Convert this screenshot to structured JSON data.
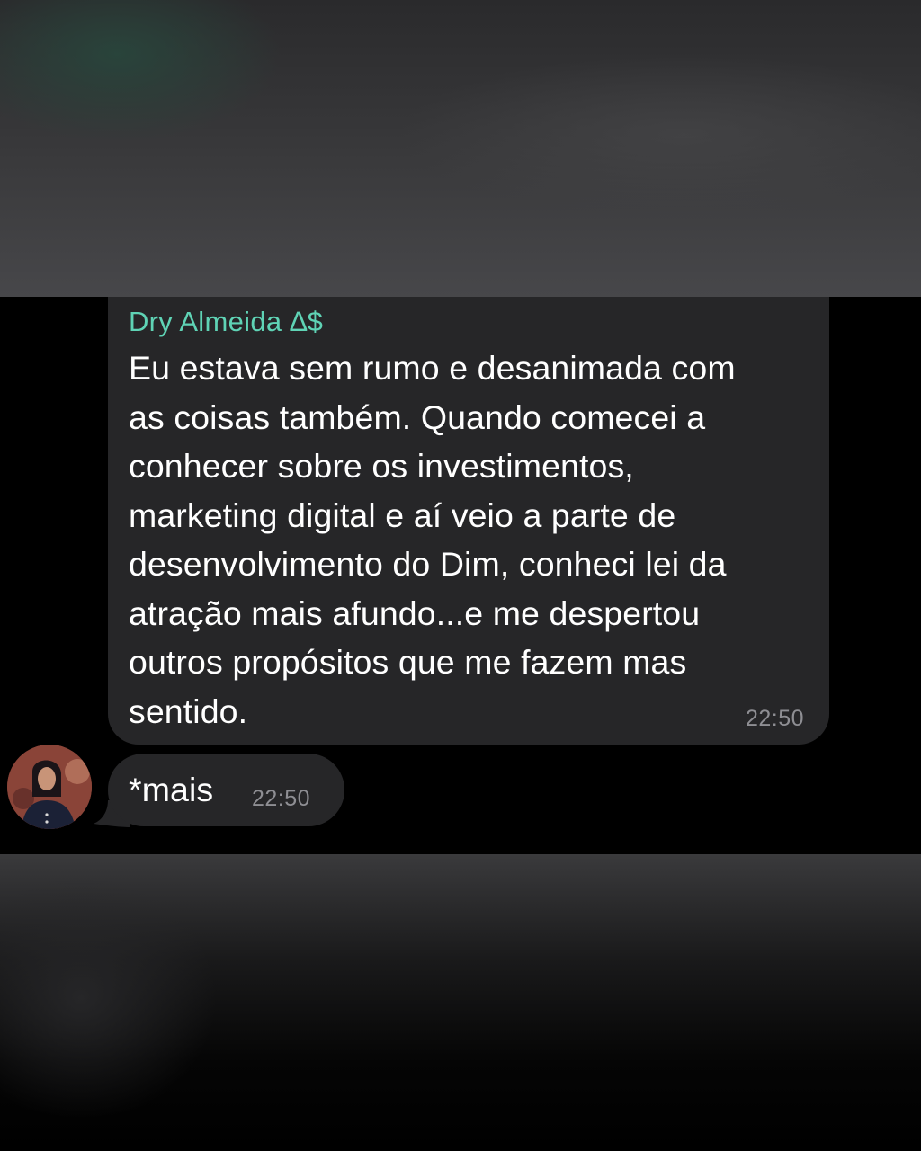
{
  "chat": {
    "messages": [
      {
        "sender": "Dry Almeida ∆$",
        "text": "Eu estava sem rumo e desanimada com\nas coisas também. Quando comecei a\nconhecer sobre os investimentos,\nmarketing digital e aí veio a parte de\ndesenvolvimento do Dim, conheci lei da\natração mais afundo...e me despertou\noutros propósitos que me fazem mas\nsentido.",
        "time": "22:50"
      },
      {
        "text": "*mais",
        "time": "22:50"
      }
    ]
  },
  "colors": {
    "sender_name": "#5fd3b5",
    "bubble": "#262628",
    "timestamp": "#8e8e93",
    "background": "#000000"
  },
  "icons": {
    "avatar": "avatar"
  }
}
